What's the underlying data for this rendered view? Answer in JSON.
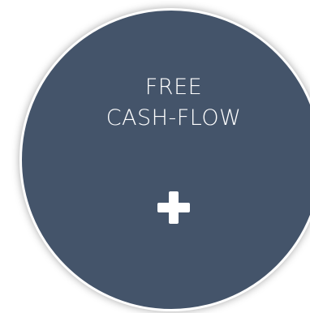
{
  "card": {
    "title_line1": "FREE",
    "title_line2": "CASH-FLOW",
    "background_color": "#44546a",
    "text_color": "#ffffff",
    "action_icon": "plus-icon"
  }
}
